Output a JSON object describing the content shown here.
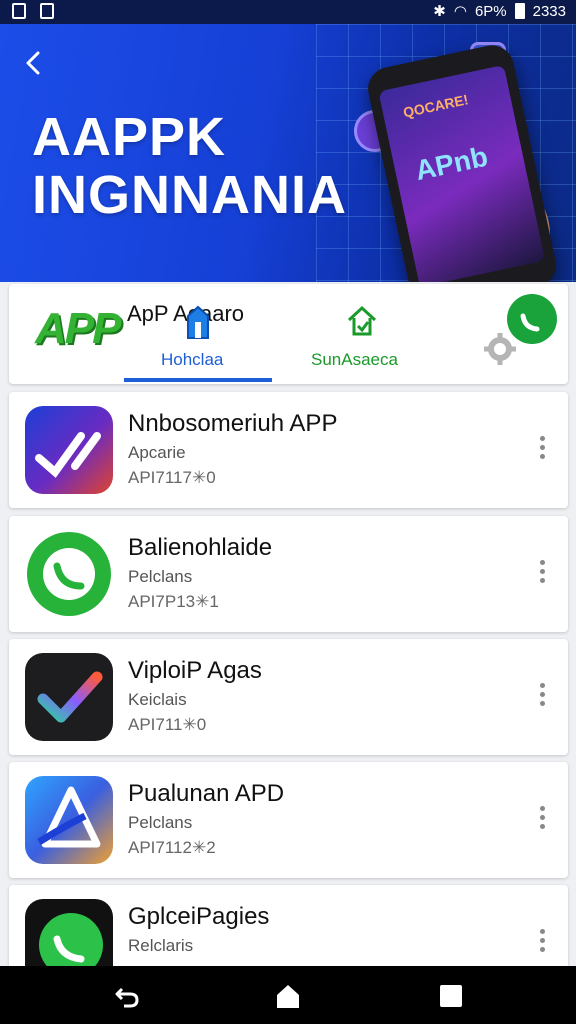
{
  "status_bar": {
    "right_text": "6P% ",
    "time": "2333"
  },
  "banner": {
    "title": "AAPPK\nINGNNANIA",
    "phone_screen_top": "QOCARE!",
    "phone_screen_main": "APnb"
  },
  "tabs": {
    "heading": "ApP Aoaaro",
    "logo": "APP",
    "tab1_label": "Hohclaa",
    "tab2_label": "SunAsaeca",
    "accent_color": "#1d5fd6"
  },
  "apps": [
    {
      "name": "Nnbosomeriuh APP",
      "category": "Apcarie",
      "version": "API7117✳0",
      "icon": "vx-gradient-icon"
    },
    {
      "name": "Balienohlaide",
      "category": "Pelclans",
      "version": "API7P13✳1",
      "icon": "green-phone-icon"
    },
    {
      "name": "ViploiP Agas",
      "category": "Keiclais",
      "version": "API711✳0",
      "icon": "checkmark-icon"
    },
    {
      "name": "Pualunan APD",
      "category": "Pelclans",
      "version": "API7112✳2",
      "icon": "shark-fin-icon"
    },
    {
      "name": "GplceiPagies",
      "category": "Relclaris",
      "version": "",
      "icon": "whatsapp-like-icon"
    }
  ]
}
